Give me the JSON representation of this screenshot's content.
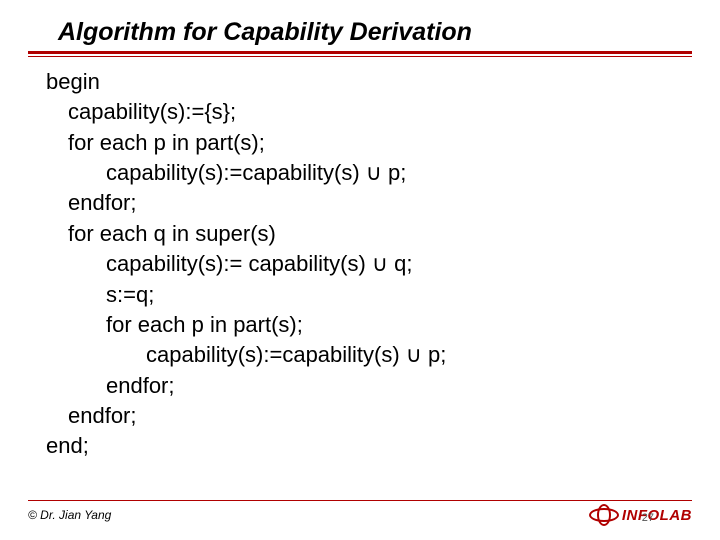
{
  "title": "Algorithm for Capability Derivation",
  "lines": [
    {
      "indent": 0,
      "text": "begin"
    },
    {
      "indent": 1,
      "text": "capability(s):={s};"
    },
    {
      "indent": 1,
      "text": "for each p in part(s);"
    },
    {
      "indent": 2,
      "text": "capability(s):=capability(s) ∪ p;"
    },
    {
      "indent": 1,
      "text": " endfor;"
    },
    {
      "indent": 1,
      "text": "for each q in super(s)"
    },
    {
      "indent": 2,
      "text": "capability(s):= capability(s) ∪ q;"
    },
    {
      "indent": 2,
      "text": "s:=q;"
    },
    {
      "indent": 2,
      "text": "for each p in part(s);"
    },
    {
      "indent": 3,
      "text": "capability(s):=capability(s) ∪ p;"
    },
    {
      "indent": 2,
      "text": "endfor;"
    },
    {
      "indent": 1,
      "text": "endfor;"
    },
    {
      "indent": 0,
      "text": "end;"
    }
  ],
  "footer": {
    "copyright": "© Dr. Jian Yang",
    "logo_text": "INFOLAB",
    "page_number": "27"
  }
}
